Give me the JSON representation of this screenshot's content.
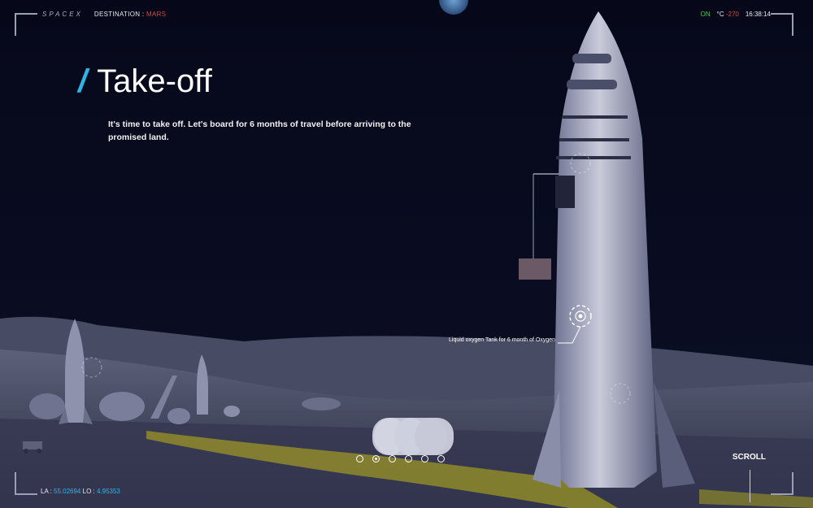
{
  "header": {
    "logo": "SPACEX",
    "destination_label": "DESTINATION : ",
    "destination_value": "MARS"
  },
  "status": {
    "power": "ON",
    "temp_unit": "°C",
    "temp_value": "-270",
    "time": "16:38:14"
  },
  "hero": {
    "slash": "/",
    "title": "Take-off",
    "description": "It's time to take off. Let's board for 6 months of travel before arriving to the promised land."
  },
  "callout": {
    "text": "Liquid oxygen Tank for 6 month of Oxygen"
  },
  "pagination": {
    "active_index": 1,
    "total": 6
  },
  "scroll": {
    "label": "SCROLL"
  },
  "coords": {
    "la_label": "LA : ",
    "la_value": "55.02694",
    "lo_label": " LO : ",
    "lo_value": "4.95353"
  },
  "colors": {
    "accent": "#2fb4e6",
    "danger": "#e0443a",
    "ok": "#4dc15a",
    "sky": "#07091a"
  }
}
